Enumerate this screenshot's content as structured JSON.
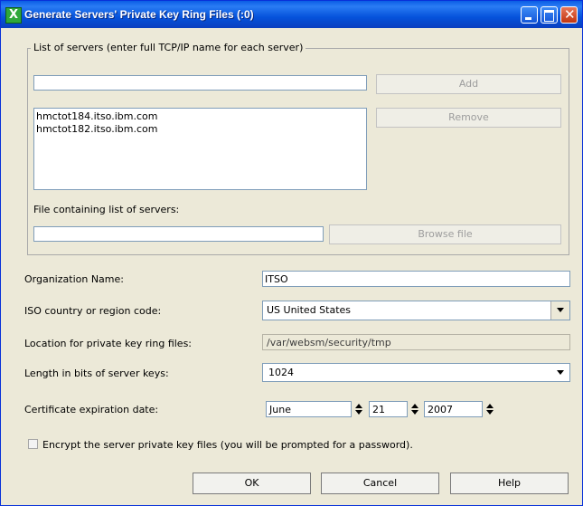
{
  "window": {
    "title": "Generate Servers' Private Key Ring Files (:0)",
    "app_icon": "X",
    "controls": [
      "minimize-icon",
      "maximize-icon",
      "close-icon"
    ]
  },
  "servers_group": {
    "label": "List of servers (enter full TCP/IP name for each server)",
    "server_input_value": "",
    "add_label": "Add",
    "remove_label": "Remove",
    "servers": [
      "hmctot184.itso.ibm.com",
      "hmctot182.itso.ibm.com"
    ],
    "file_label": "File containing list of servers:",
    "file_input_value": "",
    "browse_label": "Browse file"
  },
  "form": {
    "org_label": "Organization Name:",
    "org_value": "ITSO",
    "country_label": "ISO country or region code:",
    "country_value": "US United States",
    "location_label": "Location for private key ring files:",
    "location_value": "/var/websm/security/tmp",
    "keylen_label": "Length in bits of server keys:",
    "keylen_value": "1024",
    "expiry_label": "Certificate expiration date:",
    "expiry_month": "June",
    "expiry_day": "21",
    "expiry_year": "2007",
    "encrypt_label": "Encrypt the server private key files (you will be prompted for a password).",
    "encrypt_checked": false
  },
  "buttons": {
    "ok": "OK",
    "cancel": "Cancel",
    "help": "Help"
  }
}
